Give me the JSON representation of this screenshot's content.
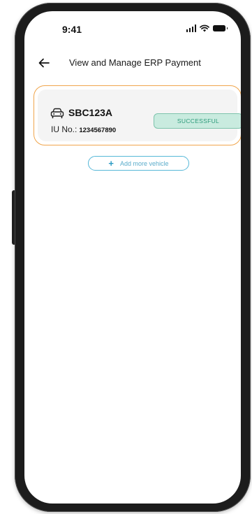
{
  "status_bar": {
    "time": "9:41",
    "icons": [
      "cellular-signal-icon",
      "wifi-icon",
      "battery-icon"
    ]
  },
  "header": {
    "back_icon": "back-arrow-icon",
    "title": "View and Manage ERP Payment"
  },
  "vehicles": [
    {
      "icon": "car-icon",
      "plate": "SBC123A",
      "iu_label": "IU No.:",
      "iu_number": "1234567890",
      "status": "SUCCESSFUL"
    }
  ],
  "add_vehicle": {
    "icon": "plus-icon",
    "label": "Add more vehicle"
  },
  "colors": {
    "card_border": "#f0a54c",
    "card_fill": "#f4f4f4",
    "status_fill": "#c9ebdf",
    "status_border": "#7dc3ac",
    "status_text": "#2c9a7a",
    "add_button_border": "#56b8d8",
    "add_button_text": "#5aaccb"
  }
}
